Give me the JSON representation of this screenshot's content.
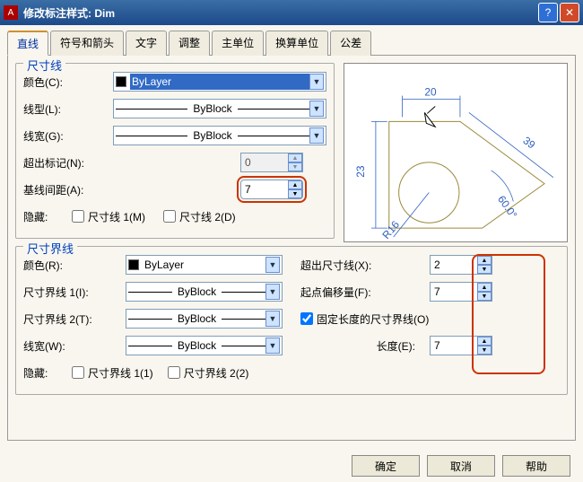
{
  "title": "修改标注样式: Dim",
  "tabs": [
    "直线",
    "符号和箭头",
    "文字",
    "调整",
    "主单位",
    "换算单位",
    "公差"
  ],
  "activeTab": 0,
  "dimLine": {
    "legend": "尺寸线",
    "color": {
      "label": "颜色(C):",
      "value": "ByLayer"
    },
    "linetype": {
      "label": "线型(L):",
      "value": "ByBlock"
    },
    "lineweight": {
      "label": "线宽(G):",
      "value": "ByBlock"
    },
    "extend": {
      "label": "超出标记(N):",
      "value": "0"
    },
    "baseline": {
      "label": "基线间距(A):",
      "value": "7"
    },
    "hide": {
      "label": "隐藏:",
      "cb1": "尺寸线 1(M)",
      "cb2": "尺寸线 2(D)"
    }
  },
  "extLine": {
    "legend": "尺寸界线",
    "color": {
      "label": "颜色(R):",
      "value": "ByLayer"
    },
    "lt1": {
      "label": "尺寸界线 1(I):",
      "value": "ByBlock"
    },
    "lt2": {
      "label": "尺寸界线 2(T):",
      "value": "ByBlock"
    },
    "lineweight": {
      "label": "线宽(W):",
      "value": "ByBlock"
    },
    "hide": {
      "label": "隐藏:",
      "cb1": "尺寸界线 1(1)",
      "cb2": "尺寸界线 2(2)"
    },
    "beyond": {
      "label": "超出尺寸线(X):",
      "value": "2"
    },
    "offset": {
      "label": "起点偏移量(F):",
      "value": "7"
    },
    "fixed": {
      "label": "固定长度的尺寸界线(O)"
    },
    "length": {
      "label": "长度(E):",
      "value": "7"
    }
  },
  "preview": {
    "d1": "20",
    "d2": "23",
    "d3": "39",
    "d4": "60.0°",
    "d5": "R16"
  },
  "buttons": {
    "ok": "确定",
    "cancel": "取消",
    "help": "帮助"
  }
}
